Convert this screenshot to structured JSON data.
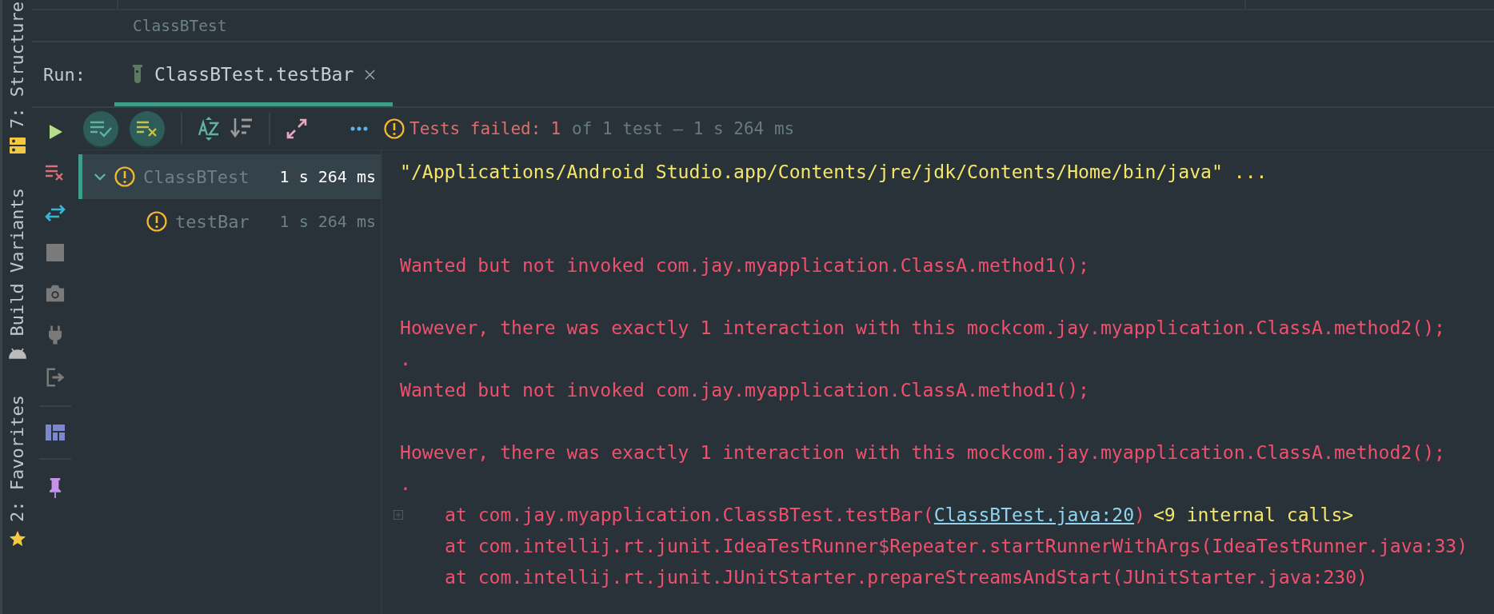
{
  "tool_windows": [
    {
      "label": "7: Structure"
    },
    {
      "label": "Build Variants"
    },
    {
      "label": "2: Favorites"
    }
  ],
  "breadcrumb": "ClassBTest",
  "run": {
    "label": "Run:",
    "tab": {
      "label": "ClassBTest.testBar",
      "selected": true
    }
  },
  "side_actions": [
    {
      "kind": "play"
    },
    {
      "kind": "failed"
    },
    {
      "kind": "swap"
    },
    {
      "kind": "stop"
    },
    {
      "kind": "camera"
    },
    {
      "kind": "plug"
    },
    {
      "kind": "exit"
    },
    {
      "kind": "sep"
    },
    {
      "kind": "layout"
    },
    {
      "kind": "sep"
    },
    {
      "kind": "pin"
    }
  ],
  "toolbar": [
    {
      "kind": "passed",
      "selected": true
    },
    {
      "kind": "ignored",
      "selected": true
    },
    {
      "kind": "sep"
    },
    {
      "kind": "sort-alpha"
    },
    {
      "kind": "sort-duration"
    },
    {
      "kind": "sep"
    },
    {
      "kind": "expand"
    },
    {
      "kind": "more"
    }
  ],
  "summary": {
    "label": "Tests failed:",
    "failed": "1",
    "rest": "of 1 test – 1 s 264 ms"
  },
  "tree": [
    {
      "name": "ClassBTest",
      "time": "1 s 264 ms",
      "expanded": true,
      "selected": true,
      "children": [
        {
          "name": "testBar",
          "time": "1 s 264 ms",
          "selected": false
        }
      ]
    }
  ],
  "console": [
    {
      "kind": "command",
      "text": "\"/Applications/Android Studio.app/Contents/jre/jdk/Contents/Home/bin/java\" ..."
    },
    {
      "kind": "blank"
    },
    {
      "kind": "blank"
    },
    {
      "kind": "error",
      "text": "Wanted but not invoked com.jay.myapplication.ClassA.method1();"
    },
    {
      "kind": "blank"
    },
    {
      "kind": "error",
      "text": "However, there was exactly 1 interaction with this mockcom.jay.myapplication.ClassA.method2();"
    },
    {
      "kind": "error",
      "text": "."
    },
    {
      "kind": "error",
      "text": "Wanted but not invoked com.jay.myapplication.ClassA.method1();"
    },
    {
      "kind": "blank"
    },
    {
      "kind": "error",
      "text": "However, there was exactly 1 interaction with this mockcom.jay.myapplication.ClassA.method2();"
    },
    {
      "kind": "error",
      "text": "."
    },
    {
      "kind": "stack",
      "foldable": true,
      "text": "at com.jay.myapplication.ClassBTest.testBar(",
      "link": "ClassBTest.java:20",
      "after": ")",
      "note": "<9 internal calls>"
    },
    {
      "kind": "stack",
      "text": "at com.intellij.rt.junit.IdeaTestRunner$Repeater.startRunnerWithArgs(IdeaTestRunner.java:33)"
    },
    {
      "kind": "stack",
      "text": "at com.intellij.rt.junit.JUnitStarter.prepareStreamsAndStart(JUnitStarter.java:230)"
    }
  ]
}
